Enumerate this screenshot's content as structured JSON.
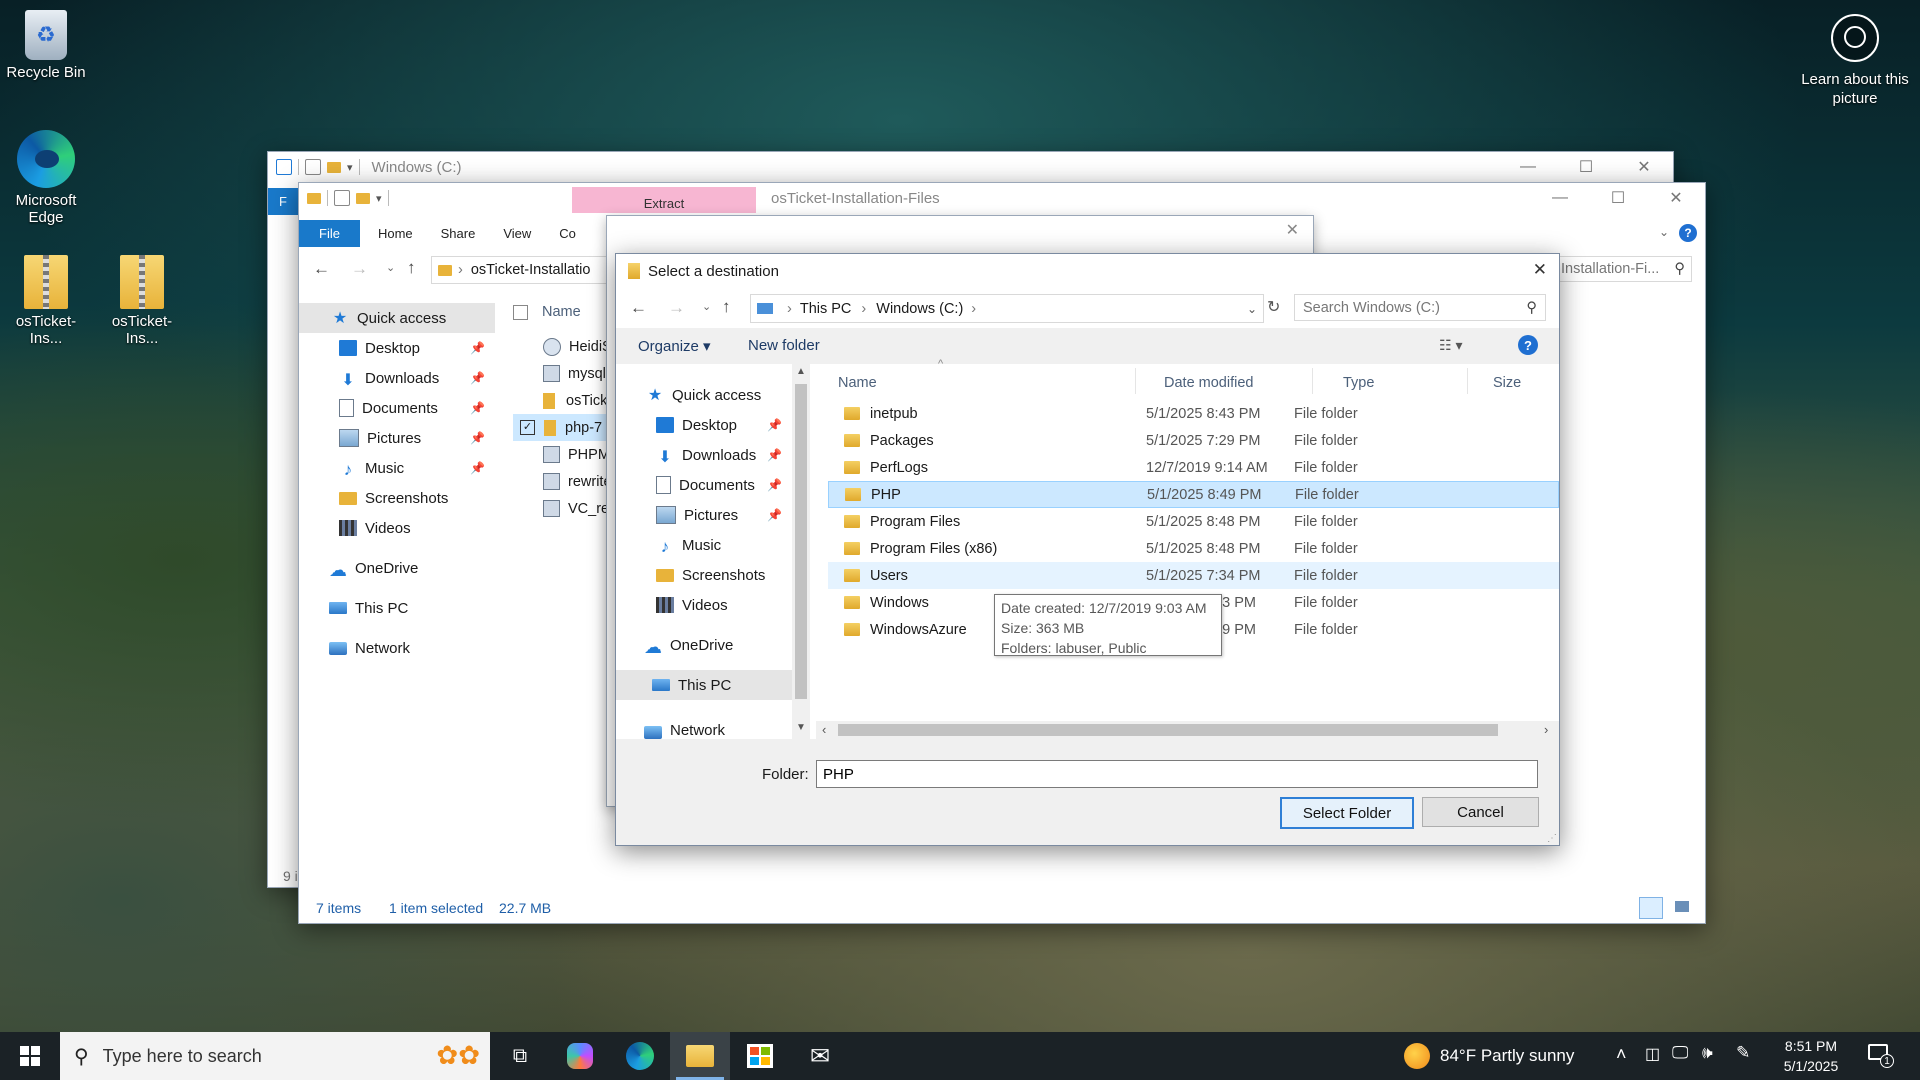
{
  "desktop": {
    "icons": [
      {
        "label": "Recycle Bin"
      },
      {
        "label": "Microsoft Edge"
      },
      {
        "label": "osTicket-Ins..."
      },
      {
        "label": "osTicket-Ins..."
      }
    ],
    "learn_picture": "Learn about this picture"
  },
  "back_window": {
    "title": "Windows (C:)"
  },
  "explorer": {
    "title": "osTicket-Installation-Files",
    "extract_tab": "Extract",
    "tabs": [
      "File",
      "Home",
      "Share",
      "View",
      "Co"
    ],
    "address": "osTicket-Installatio",
    "right_address": "Installation-Fi...",
    "column_name": "Name",
    "nav": [
      {
        "label": "Quick access"
      },
      {
        "label": "Desktop"
      },
      {
        "label": "Downloads"
      },
      {
        "label": "Documents"
      },
      {
        "label": "Pictures"
      },
      {
        "label": "Music"
      },
      {
        "label": "Screenshots"
      },
      {
        "label": "Videos"
      },
      {
        "label": "OneDrive"
      },
      {
        "label": "This PC"
      },
      {
        "label": "Network"
      }
    ],
    "files": [
      "HeidiS",
      "mysql-",
      "osTick",
      "php-7",
      "PHPM",
      "rewrite",
      "VC_re"
    ],
    "status_items": "7 items",
    "status_selected": "1 item selected",
    "status_size": "22.7 MB",
    "side_num": "9 i"
  },
  "dialog": {
    "title": "Select a destination",
    "breadcrumb": [
      "This PC",
      "Windows (C:)"
    ],
    "search_placeholder": "Search Windows (C:)",
    "organize": "Organize",
    "new_folder": "New folder",
    "columns": {
      "name": "Name",
      "date": "Date modified",
      "type": "Type",
      "size": "Size"
    },
    "nav": [
      {
        "label": "Quick access"
      },
      {
        "label": "Desktop"
      },
      {
        "label": "Downloads"
      },
      {
        "label": "Documents"
      },
      {
        "label": "Pictures"
      },
      {
        "label": "Music"
      },
      {
        "label": "Screenshots"
      },
      {
        "label": "Videos"
      },
      {
        "label": "OneDrive"
      },
      {
        "label": "This PC"
      },
      {
        "label": "Network"
      }
    ],
    "rows": [
      {
        "name": "inetpub",
        "date": "5/1/2025 8:43 PM",
        "type": "File folder"
      },
      {
        "name": "Packages",
        "date": "5/1/2025 7:29 PM",
        "type": "File folder"
      },
      {
        "name": "PerfLogs",
        "date": "12/7/2019 9:14 AM",
        "type": "File folder"
      },
      {
        "name": "PHP",
        "date": "5/1/2025 8:49 PM",
        "type": "File folder"
      },
      {
        "name": "Program Files",
        "date": "5/1/2025 8:48 PM",
        "type": "File folder"
      },
      {
        "name": "Program Files (x86)",
        "date": "5/1/2025 8:48 PM",
        "type": "File folder"
      },
      {
        "name": "Users",
        "date": "5/1/2025 7:34 PM",
        "type": "File folder"
      },
      {
        "name": "Windows",
        "date": "8:43 PM",
        "type": "File folder"
      },
      {
        "name": "WindowsAzure",
        "date": "7:29 PM",
        "type": "File folder"
      }
    ],
    "tooltip": [
      "Date created: 12/7/2019 9:03 AM",
      "Size: 363 MB",
      "Folders: labuser, Public"
    ],
    "folder_label": "Folder:",
    "folder_value": "PHP",
    "select_button": "Select Folder",
    "cancel_button": "Cancel"
  },
  "taskbar": {
    "search_placeholder": "Type here to search",
    "weather": "84°F  Partly sunny",
    "time": "8:51 PM",
    "date": "5/1/2025",
    "notification_count": "1"
  }
}
